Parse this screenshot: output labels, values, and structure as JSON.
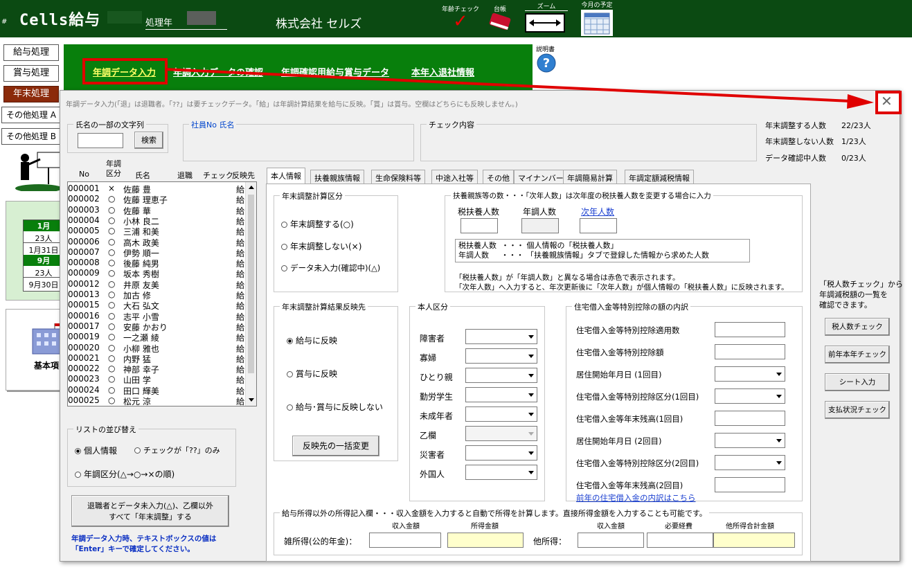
{
  "header": {
    "title": "Cells給与",
    "year_label": "処理年",
    "company": "株式会社 セルズ",
    "tools": [
      {
        "label": "年齢チェック",
        "icon": "checkmark-icon"
      },
      {
        "label": "台帳",
        "icon": "book-icon"
      },
      {
        "label": "ズーム",
        "icon": "zoom-arrows-icon"
      },
      {
        "label": "今月の予定",
        "icon": "calendar-icon"
      }
    ]
  },
  "sidebar": {
    "buttons": [
      "給与処理",
      "賞与処理",
      "年末処理",
      "その他処理 A",
      "その他処理 B"
    ],
    "cal": {
      "m1": "1月",
      "c1": "23人",
      "d1": "1月31日",
      "m2": "9月",
      "c2": "23人",
      "d2": "9月30日"
    },
    "kihon": "基本項"
  },
  "nav": {
    "links": [
      "年調データ入力",
      "年調入力データの確認",
      "年調確認用給与賞与データ",
      "本年入退社情報"
    ],
    "help_label": "説明書"
  },
  "dialog": {
    "caption": "年調データ入力(「退」は退職者。「??」は要チェックデータ。「給」は年調計算結果を給与に反映。「賞」は賞与。空欄はどちらにも反映しません。)",
    "search": {
      "title": "氏名の一部の文字列",
      "button": "検索"
    },
    "employee": {
      "title": "社員No 氏名"
    },
    "check": {
      "title": "チェック内容"
    },
    "stats": [
      {
        "label": "年末調整する人数",
        "value": "22/23人"
      },
      {
        "label": "年末調整しない人数",
        "value": "1/23人"
      },
      {
        "label": "データ確認中人数",
        "value": "0/23人"
      }
    ],
    "list_headers": {
      "no": "No",
      "kubun": "年調\n区分",
      "name": "氏名",
      "taishoku": "退職",
      "check": "チェック",
      "hanei": "反映先"
    },
    "rows": [
      {
        "no": "000001",
        "k": "×",
        "name": "佐藤 豊",
        "h": "給"
      },
      {
        "no": "000002",
        "k": "○",
        "name": "佐藤 理恵子",
        "h": "給"
      },
      {
        "no": "000003",
        "k": "○",
        "name": "佐藤 華",
        "h": "給"
      },
      {
        "no": "000004",
        "k": "○",
        "name": "小林 良二",
        "h": "給"
      },
      {
        "no": "000005",
        "k": "○",
        "name": "三浦 和美",
        "h": "給"
      },
      {
        "no": "000006",
        "k": "○",
        "name": "高木 政美",
        "h": "給"
      },
      {
        "no": "000007",
        "k": "○",
        "name": "伊勢 順一",
        "h": "給"
      },
      {
        "no": "000008",
        "k": "○",
        "name": "後藤 純男",
        "h": "給"
      },
      {
        "no": "000009",
        "k": "○",
        "name": "坂本 秀樹",
        "h": "給"
      },
      {
        "no": "000012",
        "k": "○",
        "name": "井原 友美",
        "h": "給"
      },
      {
        "no": "000013",
        "k": "○",
        "name": "加古 修",
        "h": "給"
      },
      {
        "no": "000015",
        "k": "○",
        "name": "大石 弘文",
        "h": "給"
      },
      {
        "no": "000016",
        "k": "○",
        "name": "志平 小雪",
        "h": "給"
      },
      {
        "no": "000017",
        "k": "○",
        "name": "安藤 かおり",
        "h": "給"
      },
      {
        "no": "000019",
        "k": "○",
        "name": "一之瀬 綾",
        "h": "給"
      },
      {
        "no": "000020",
        "k": "○",
        "name": "小柳 雅也",
        "h": "給"
      },
      {
        "no": "000021",
        "k": "○",
        "name": "内野 猛",
        "h": "給"
      },
      {
        "no": "000022",
        "k": "○",
        "name": "神部 幸子",
        "h": "給"
      },
      {
        "no": "000023",
        "k": "○",
        "name": "山田 学",
        "h": "給"
      },
      {
        "no": "000024",
        "k": "○",
        "name": "田口 輝美",
        "h": "給"
      },
      {
        "no": "000025",
        "k": "○",
        "name": "松元 涼",
        "h": "給"
      }
    ],
    "sort": {
      "title": "リストの並び替え",
      "opt1": "個人情報",
      "opt2": "チェックが「??」のみ",
      "opt3": "年調区分(△→○→×の順)"
    },
    "bulk_button": {
      "line1": "退職者とデータ未入力(△)、乙欄以外",
      "line2": "すべて「年末調整」する"
    },
    "note": {
      "line1": "年調データ入力時、テキストボックスの値は",
      "line2": "「Enter」キーで確定してください。"
    },
    "tabs": [
      "本人情報",
      "扶養親族情報",
      "生命保険料等",
      "中途入社等",
      "その他",
      "マイナンバー",
      "年調簡易計算",
      "年調定額減税情報"
    ],
    "calc": {
      "title": "年末調整計算区分",
      "opt1": "年末調整する(○)",
      "opt2": "年末調整しない(×)",
      "opt3": "データ未入力(確認中)(△)"
    },
    "dep": {
      "title": "扶養親族等の数・・・「次年人数」は次年度の税扶養人数を変更する場合に入力",
      "c1": "税扶養人数",
      "c2": "年調人数",
      "c3": "次年人数",
      "e1": "税扶養人数  ・・・ 個人情報の「税扶養人数」",
      "e2": "年調人数     ・・・ 「扶養親族情報」タブで登録した情報から求めた人数",
      "n1": "「税扶養人数」が「年調人数」と異なる場合は赤色で表示されます。",
      "n2": "「次年人数」へ入力すると、年次更新後に「次年人数」が個人情報の「税扶養人数」に反映されます。"
    },
    "reflect": {
      "title": "年末調整計算結果反映先",
      "opt1": "給与に反映",
      "opt2": "賞与に反映",
      "opt3": "給与･賞与に反映しない",
      "button": "反映先の一括変更"
    },
    "self": {
      "title": "本人区分",
      "items": [
        "障害者",
        "寡婦",
        "ひとり親",
        "勤労学生",
        "未成年者",
        "乙欄",
        "災害者",
        "外国人"
      ]
    },
    "loan": {
      "title": "住宅借入金等特別控除の額の内訳",
      "items": [
        "住宅借入金等特別控除適用数",
        "住宅借入金等特別控除額",
        "居住開始年月日 (1回目)",
        "住宅借入金等特別控除区分(1回目)",
        "住宅借入金等年末残高(1回目)",
        "居住開始年月日 (2回目)",
        "住宅借入金等特別控除区分(2回目)",
        "住宅借入金等年末残高(2回目)"
      ],
      "link": "前年の住宅借入金の内訳はこちら"
    },
    "income": {
      "title": "給与所得以外の所得記入欄・・・収入金額を入力すると自動で所得を計算します。直接所得金額を入力することも可能です。",
      "h1": "収入金額",
      "h2": "所得金額",
      "h3": "収入金額",
      "h4": "必要経費",
      "h5": "他所得合計金額",
      "l1": "雑所得(公的年金)：",
      "l2": "他所得："
    },
    "right": {
      "note": "「税人数チェック」から\n年調減税額の一覧を\n確認できます。",
      "buttons": [
        "税人数チェック",
        "前年本年チェック",
        "シート入力",
        "支払状況チェック"
      ]
    }
  }
}
